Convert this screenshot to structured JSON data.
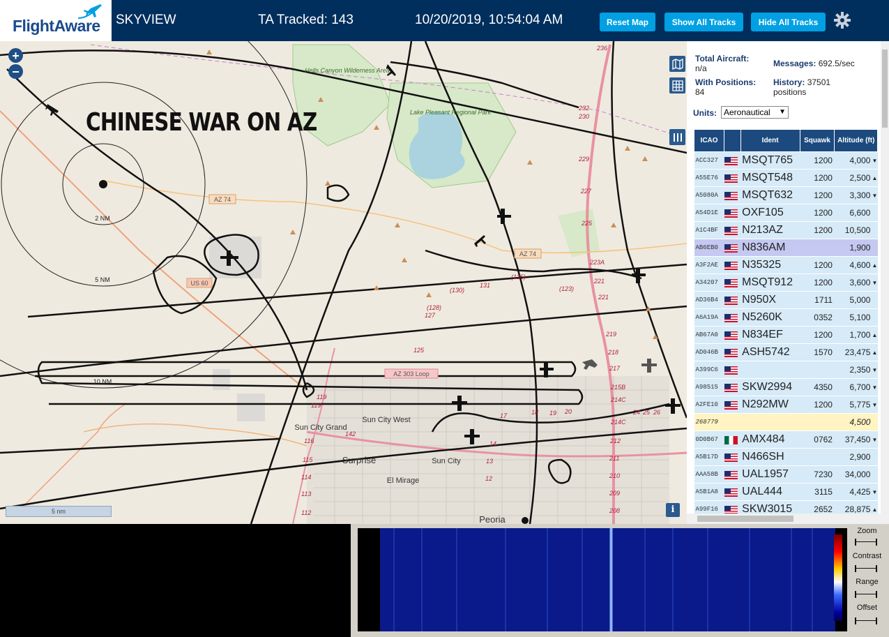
{
  "header": {
    "brand": "FlightAware",
    "site_name": "SKYVIEW",
    "ta_tracked": "TA Tracked: 143",
    "clock": "10/20/2019, 10:54:04 AM",
    "buttons": {
      "reset": "Reset Map",
      "show_all": "Show All Tracks",
      "hide_all": "Hide All Tracks"
    }
  },
  "map": {
    "title": "CHINESE WAR ON AZ",
    "scale": "5 nm",
    "zoom_in": "+",
    "zoom_out": "−",
    "info": "i",
    "range_rings": [
      "2 NM",
      "5 NM",
      "10 NM"
    ],
    "places": [
      "Hells Canyon Wilderness Area",
      "Lake Pleasant Regional Park",
      "Sun City Grand",
      "Sun City West",
      "Surprise",
      "Sun City",
      "El Mirage",
      "Peoria"
    ],
    "road_labels": [
      "AZ 74",
      "AZ 74",
      "US 60",
      "AZ 303 Loop"
    ],
    "mileposts": [
      "236",
      "232",
      "230",
      "229",
      "227",
      "225",
      "223A",
      "221",
      "221",
      "219",
      "218",
      "217",
      "215B",
      "214C",
      "214C",
      "212",
      "211",
      "210",
      "209",
      "208",
      "131",
      "(130)",
      "(135)",
      "(128)",
      "127",
      "125",
      "(123)",
      "119",
      "119",
      "116",
      "115",
      "114",
      "113",
      "112",
      "142",
      "14",
      "13",
      "12",
      "17",
      "18",
      "19",
      "20",
      "24",
      "25",
      "26"
    ]
  },
  "panel": {
    "total_aircraft_label": "Total Aircraft:",
    "total_aircraft_value": "n/a",
    "with_positions_label": "With Positions:",
    "with_positions_value": "84",
    "messages_label": "Messages:",
    "messages_value": "692.5/sec",
    "history_label": "History:",
    "history_value": "37501 positions",
    "units_label": "Units:",
    "units_value": "Aeronautical",
    "columns": [
      "ICAO",
      "",
      "Ident",
      "Squawk",
      "Altitude (ft)"
    ],
    "rows": [
      {
        "icao": "ACC327",
        "flag": "us",
        "ident": "MSQT765",
        "squawk": "1200",
        "alt": "4,000",
        "trend": "▼"
      },
      {
        "icao": "A55E76",
        "flag": "us",
        "ident": "MSQT548",
        "squawk": "1200",
        "alt": "2,500",
        "trend": "▲"
      },
      {
        "icao": "A5080A",
        "flag": "us",
        "ident": "MSQT632",
        "squawk": "1200",
        "alt": "3,300",
        "trend": "▼"
      },
      {
        "icao": "A54D1E",
        "flag": "us",
        "ident": "OXF105",
        "squawk": "1200",
        "alt": "6,600",
        "trend": ""
      },
      {
        "icao": "A1C4BF",
        "flag": "us",
        "ident": "N213AZ",
        "squawk": "1200",
        "alt": "10,500",
        "trend": ""
      },
      {
        "icao": "AB6EB0",
        "flag": "us",
        "ident": "N836AM",
        "squawk": "",
        "alt": "1,900",
        "trend": "",
        "state": "sel"
      },
      {
        "icao": "A3F2AE",
        "flag": "us",
        "ident": "N35325",
        "squawk": "1200",
        "alt": "4,600",
        "trend": "▲"
      },
      {
        "icao": "A34207",
        "flag": "us",
        "ident": "MSQT912",
        "squawk": "1200",
        "alt": "3,600",
        "trend": "▼"
      },
      {
        "icao": "AD36B4",
        "flag": "us",
        "ident": "N950X",
        "squawk": "1711",
        "alt": "5,000",
        "trend": ""
      },
      {
        "icao": "A6A19A",
        "flag": "us",
        "ident": "N5260K",
        "squawk": "0352",
        "alt": "5,100",
        "trend": ""
      },
      {
        "icao": "AB67A0",
        "flag": "us",
        "ident": "N834EF",
        "squawk": "1200",
        "alt": "1,700",
        "trend": "▲"
      },
      {
        "icao": "AD046B",
        "flag": "us",
        "ident": "ASH5742",
        "squawk": "1570",
        "alt": "23,475",
        "trend": "▲"
      },
      {
        "icao": "A399C6",
        "flag": "us",
        "ident": "",
        "squawk": "",
        "alt": "2,350",
        "trend": "▼"
      },
      {
        "icao": "A98515",
        "flag": "us",
        "ident": "SKW2994",
        "squawk": "4350",
        "alt": "6,700",
        "trend": "▼"
      },
      {
        "icao": "A2FE10",
        "flag": "us",
        "ident": "N292MW",
        "squawk": "1200",
        "alt": "5,775",
        "trend": "▼"
      },
      {
        "icao": "268779",
        "flag": "",
        "ident": "",
        "squawk": "",
        "alt": "4,500",
        "trend": "",
        "state": "noloc"
      },
      {
        "icao": "0D0B67",
        "flag": "mx",
        "ident": "AMX484",
        "squawk": "0762",
        "alt": "37,450",
        "trend": "▼"
      },
      {
        "icao": "A5B17D",
        "flag": "us",
        "ident": "N466SH",
        "squawk": "",
        "alt": "2,900",
        "trend": ""
      },
      {
        "icao": "AAA58B",
        "flag": "us",
        "ident": "UAL1957",
        "squawk": "7230",
        "alt": "34,000",
        "trend": ""
      },
      {
        "icao": "A5B1A8",
        "flag": "us",
        "ident": "UAL444",
        "squawk": "3115",
        "alt": "4,425",
        "trend": "▼"
      },
      {
        "icao": "A99F16",
        "flag": "us",
        "ident": "SKW3015",
        "squawk": "2652",
        "alt": "28,875",
        "trend": "▲"
      }
    ]
  },
  "waterfall": {
    "labels": [
      "Zoom",
      "Contrast",
      "Range",
      "Offset"
    ]
  },
  "colors": {
    "header_bg": "#002f5d",
    "button": "#00a0e3",
    "table_header": "#1c4a7e",
    "row": "#d6eaf7",
    "selected_row": "#c5c8f0",
    "no_position_row": "#fff4c2"
  }
}
